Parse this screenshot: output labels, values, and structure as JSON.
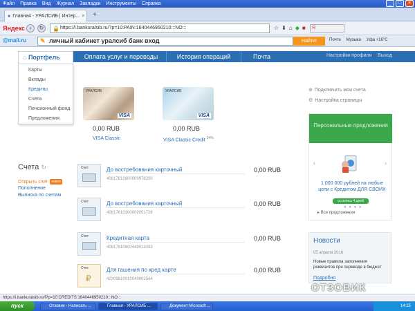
{
  "browser": {
    "menu": [
      "Файл",
      "Правка",
      "Вид",
      "Журнал",
      "Закладки",
      "Инструменты",
      "Справка"
    ],
    "tab_title": "Главная - УРАЛСИБ | Интер...",
    "url": "https://i.bankuralsib.ru/?p=10:PAIN:1640446950210:::NO:::",
    "yandex": "Яндекс"
  },
  "mailru_bar": {
    "logo": "@mail.ru",
    "search_value": "личный кабинет уралсиб банк вход",
    "find_button": "Найти!",
    "items": [
      "Почта",
      "Музыка",
      "Уфа +16°C"
    ]
  },
  "site_nav": {
    "portfolio": "Портфель",
    "items": [
      "Оплата услуг и переводы",
      "История операций",
      "Почта"
    ],
    "right": [
      "Настройки профиля",
      "Выход"
    ]
  },
  "portfolio_menu": [
    "Карты",
    "Вклады",
    "Кредиты",
    "Счета",
    "Пенсионный фонд",
    "Предложения"
  ],
  "cards": [
    {
      "amount": "0,00 RUB",
      "name": "VISA Classic",
      "suffix": "",
      "brand": "VISA",
      "bank": "УРАЛСИБ"
    },
    {
      "amount": "0,00 RUB",
      "name": "VISA Classic Credit",
      "suffix": "24%",
      "brand": "VISA",
      "bank": "УРАЛСИБ"
    }
  ],
  "right_links": [
    "Подключить мои счета",
    "Настройка страницы"
  ],
  "offers": {
    "header": "Персональные предложения",
    "text": "1 000 000 рублей на любые цели с Кредитом ДЛЯ СВОИХ",
    "button": "остались 4 дней",
    "all": "Все предложения"
  },
  "news": {
    "title": "Новости",
    "date": "05 апреля 2016",
    "text": "Новые правила заполнения реквизитов при переводе в бюджет",
    "more": "Подробно"
  },
  "accounts": {
    "title": "Счета",
    "open": "Открыть счет",
    "new_badge": "новое",
    "replenish": "Пополнение",
    "statement": "Выписка по счетам",
    "icon_label": "Счет",
    "rows": [
      {
        "name": "До востребования карточный",
        "number": "40817810600009978200",
        "balance": "0,00 RUB"
      },
      {
        "name": "До востребования карточный",
        "number": "40817810300009051728",
        "balance": "0,00 RUB"
      },
      {
        "name": "Кредитная карта",
        "number": "40817810600449013453",
        "balance": "0,00 RUB"
      },
      {
        "name": "Для гашения по кред карте",
        "number": "42309810010049002564",
        "balance": "0,00 RUB"
      }
    ]
  },
  "status_url": "https://i.bankuralsib.ru/f?p=10:CREDITS:1640446950210:::NO:::",
  "taskbar": {
    "start": "пуск",
    "tasks": [
      "Отзовик - Написать ...",
      "Главная - УРАЛСИБ ...",
      "Документ Microsoft ..."
    ],
    "clock": "14:25"
  },
  "watermark": "ОТЗОВИК"
}
